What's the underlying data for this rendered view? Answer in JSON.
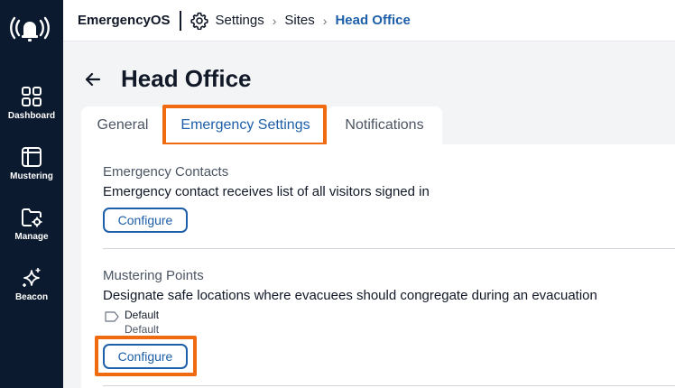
{
  "sidebar": {
    "items": [
      {
        "label": "Dashboard",
        "icon": "grid-icon"
      },
      {
        "label": "Mustering",
        "icon": "layout-icon"
      },
      {
        "label": "Manage",
        "icon": "folder-gear-icon"
      },
      {
        "label": "Beacon",
        "icon": "sparkle-icon"
      }
    ]
  },
  "topbar": {
    "brand": "EmergencyOS",
    "breadcrumb": [
      "Settings",
      "Sites",
      "Head Office"
    ]
  },
  "page": {
    "title": "Head Office"
  },
  "tabs": [
    {
      "label": "General",
      "active": false
    },
    {
      "label": "Emergency Settings",
      "active": true
    },
    {
      "label": "Notifications",
      "active": false
    }
  ],
  "sections": {
    "contacts": {
      "title": "Emergency Contacts",
      "description": "Emergency contact receives list of all visitors signed in",
      "button": "Configure"
    },
    "mustering": {
      "title": "Mustering Points",
      "description": "Designate safe locations where evacuees should congregate during an evacuation",
      "point_name": "Default",
      "point_sub": "Default",
      "button": "Configure"
    }
  },
  "colors": {
    "sidebar_bg": "#0b1a2e",
    "accent": "#1d5fa8",
    "highlight": "#f06a0f"
  }
}
